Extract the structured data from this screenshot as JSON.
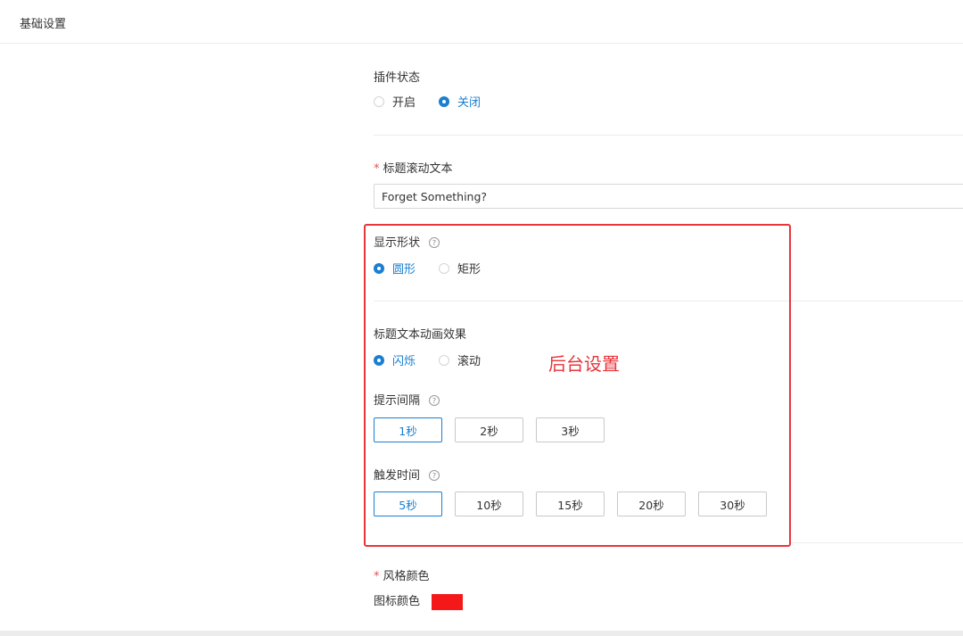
{
  "header": {
    "title": "基础设置"
  },
  "plugin_status": {
    "label": "插件状态",
    "options": [
      {
        "label": "开启",
        "checked": false
      },
      {
        "label": "关闭",
        "checked": true
      }
    ]
  },
  "title_text": {
    "required_mark": "*",
    "label": "标题滚动文本",
    "value": "Forget Something?"
  },
  "display_shape": {
    "label": "显示形状",
    "help": "?",
    "options": [
      {
        "label": "圆形",
        "checked": true
      },
      {
        "label": "矩形",
        "checked": false
      }
    ]
  },
  "animation": {
    "label": "标题文本动画效果",
    "options": [
      {
        "label": "闪烁",
        "checked": true
      },
      {
        "label": "滚动",
        "checked": false
      }
    ]
  },
  "annotation": "后台设置",
  "interval": {
    "label": "提示间隔",
    "help": "?",
    "options": [
      "1秒",
      "2秒",
      "3秒"
    ],
    "selected": "1秒"
  },
  "trigger": {
    "label": "触发时间",
    "help": "?",
    "options": [
      "5秒",
      "10秒",
      "15秒",
      "20秒",
      "30秒"
    ],
    "selected": "5秒"
  },
  "style_color": {
    "required_mark": "*",
    "label": "风格颜色",
    "icon_color_label": "图标颜色",
    "icon_color": "#f51818"
  },
  "colors": {
    "accent": "#1a7fd1",
    "annotation": "#e8353a"
  }
}
